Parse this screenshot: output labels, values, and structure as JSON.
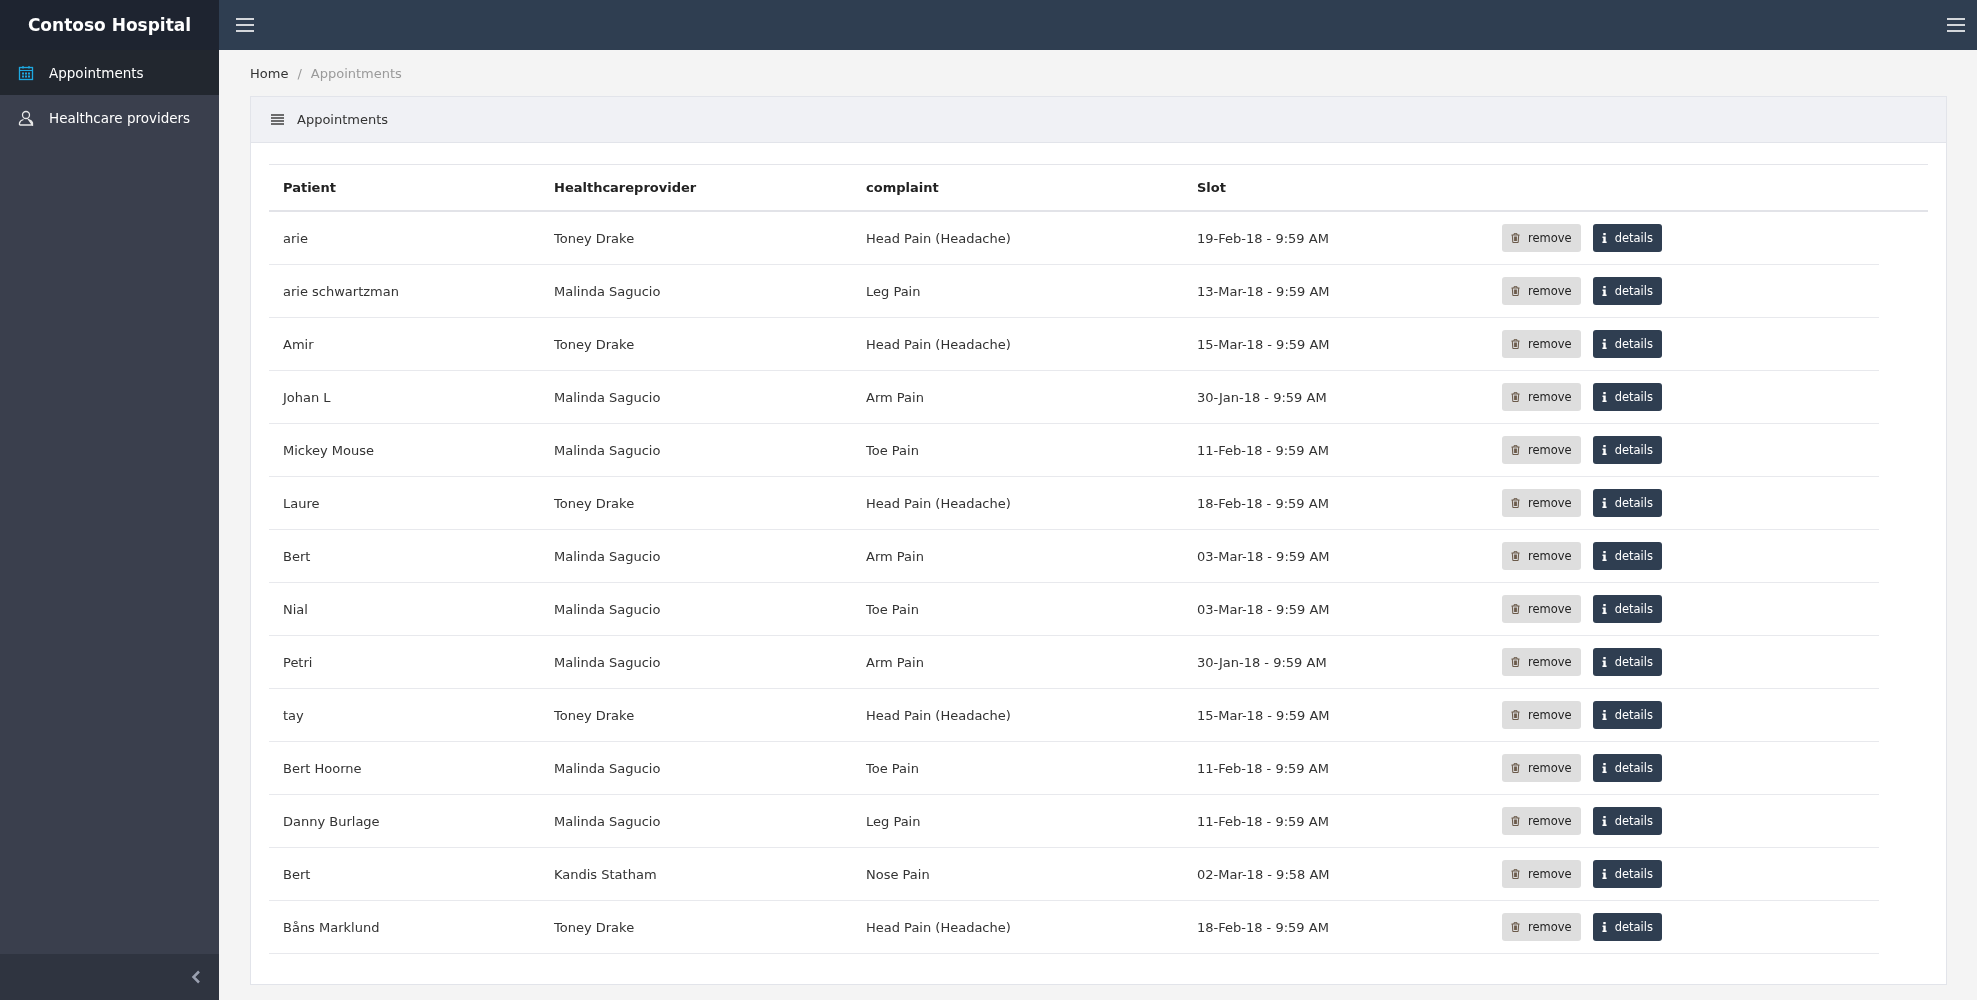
{
  "brand": "Contoso Hospital",
  "sidebar": {
    "items": [
      {
        "label": "Appointments",
        "kind": "calendar",
        "selected": true
      },
      {
        "label": "Healthcare providers",
        "kind": "person",
        "selected": false
      }
    ]
  },
  "breadcrumb": {
    "items": [
      "Home",
      "Appointments"
    ],
    "separator": "/"
  },
  "card": {
    "title": "Appointments"
  },
  "table": {
    "columns": [
      "Patient",
      "Healthcareprovider",
      "complaint",
      "Slot"
    ],
    "rows": [
      {
        "cells": [
          "arie",
          "Toney Drake",
          "Head Pain (Headache)",
          "19-Feb-18 - 9:59 AM"
        ],
        "actions": [
          "remove",
          "details"
        ]
      },
      {
        "cells": [
          "arie schwartzman",
          "Malinda Sagucio",
          "Leg Pain",
          "13-Mar-18 - 9:59 AM"
        ],
        "actions": [
          "remove",
          "details"
        ]
      },
      {
        "cells": [
          "Amir",
          "Toney Drake",
          "Head Pain (Headache)",
          "15-Mar-18 - 9:59 AM"
        ],
        "actions": [
          "remove",
          "details"
        ]
      },
      {
        "cells": [
          "Johan L",
          "Malinda Sagucio",
          "Arm Pain",
          "30-Jan-18 - 9:59 AM"
        ],
        "actions": [
          "remove",
          "details"
        ]
      },
      {
        "cells": [
          "Mickey Mouse",
          "Malinda Sagucio",
          "Toe Pain",
          "11-Feb-18 - 9:59 AM"
        ],
        "actions": [
          "remove",
          "details"
        ]
      },
      {
        "cells": [
          "Laure",
          "Toney Drake",
          "Head Pain (Headache)",
          "18-Feb-18 - 9:59 AM"
        ],
        "actions": [
          "remove",
          "details"
        ]
      },
      {
        "cells": [
          "Bert",
          "Malinda Sagucio",
          "Arm Pain",
          "03-Mar-18 - 9:59 AM"
        ],
        "actions": [
          "remove",
          "details"
        ]
      },
      {
        "cells": [
          "Nial",
          "Malinda Sagucio",
          "Toe Pain",
          "03-Mar-18 - 9:59 AM"
        ],
        "actions": [
          "remove",
          "details"
        ]
      },
      {
        "cells": [
          "Petri",
          "Malinda Sagucio",
          "Arm Pain",
          "30-Jan-18 - 9:59 AM"
        ],
        "actions": [
          "remove",
          "details"
        ]
      },
      {
        "cells": [
          "tay",
          "Toney Drake",
          "Head Pain (Headache)",
          "15-Mar-18 - 9:59 AM"
        ],
        "actions": [
          "remove",
          "details"
        ]
      },
      {
        "cells": [
          "Bert Hoorne",
          "Malinda Sagucio",
          "Toe Pain",
          "11-Feb-18 - 9:59 AM"
        ],
        "actions": [
          "remove",
          "details"
        ]
      },
      {
        "cells": [
          "Danny Burlage",
          "Malinda Sagucio",
          "Leg Pain",
          "11-Feb-18 - 9:59 AM"
        ],
        "actions": [
          "remove",
          "details"
        ]
      },
      {
        "cells": [
          "Bert",
          "Kandis Statham",
          "Nose Pain",
          "02-Mar-18 - 9:58 AM"
        ],
        "actions": [
          "remove",
          "details"
        ]
      },
      {
        "cells": [
          "Båns Marklund",
          "Toney Drake",
          "Head Pain (Headache)",
          "18-Feb-18 - 9:59 AM"
        ],
        "actions": [
          "remove",
          "details"
        ]
      }
    ]
  }
}
